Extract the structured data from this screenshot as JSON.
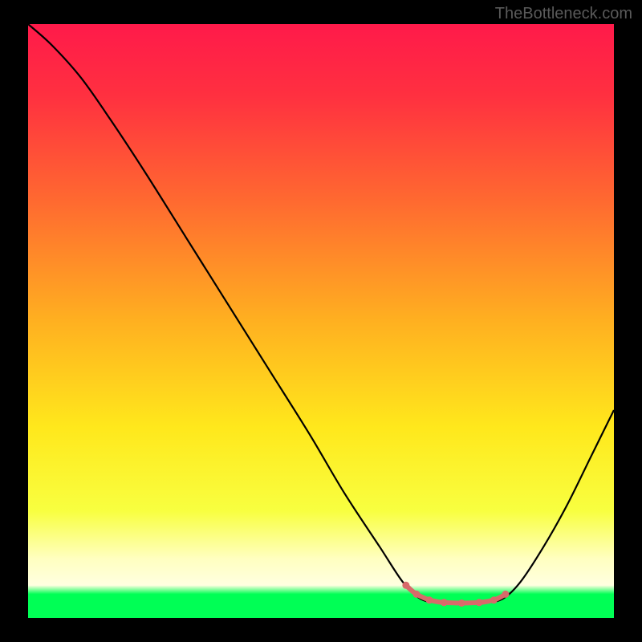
{
  "watermark": "TheBottleneck.com",
  "chart_data": {
    "type": "line",
    "title": "",
    "xlabel": "",
    "ylabel": "",
    "x_range": [
      0,
      100
    ],
    "y_range": [
      0,
      100
    ],
    "gradient_stops": [
      {
        "offset": 0.0,
        "color": "#ff1a4a"
      },
      {
        "offset": 0.12,
        "color": "#ff3040"
      },
      {
        "offset": 0.3,
        "color": "#ff6a30"
      },
      {
        "offset": 0.5,
        "color": "#ffb020"
      },
      {
        "offset": 0.68,
        "color": "#ffe81c"
      },
      {
        "offset": 0.82,
        "color": "#f8ff40"
      },
      {
        "offset": 0.9,
        "color": "#ffffc0"
      },
      {
        "offset": 0.945,
        "color": "#ffffe0"
      },
      {
        "offset": 0.96,
        "color": "#00ff55"
      },
      {
        "offset": 1.0,
        "color": "#00ff55"
      }
    ],
    "curve": [
      {
        "x": 0,
        "y": 100
      },
      {
        "x": 4,
        "y": 96.5
      },
      {
        "x": 9,
        "y": 91
      },
      {
        "x": 14,
        "y": 84
      },
      {
        "x": 20,
        "y": 75
      },
      {
        "x": 27,
        "y": 64
      },
      {
        "x": 34,
        "y": 53
      },
      {
        "x": 41,
        "y": 42
      },
      {
        "x": 48,
        "y": 31
      },
      {
        "x": 54,
        "y": 21
      },
      {
        "x": 60,
        "y": 12
      },
      {
        "x": 64,
        "y": 6
      },
      {
        "x": 67,
        "y": 3.2
      },
      {
        "x": 70,
        "y": 2.6
      },
      {
        "x": 74,
        "y": 2.5
      },
      {
        "x": 78,
        "y": 2.6
      },
      {
        "x": 81,
        "y": 3.2
      },
      {
        "x": 84,
        "y": 6
      },
      {
        "x": 88,
        "y": 12
      },
      {
        "x": 92,
        "y": 19
      },
      {
        "x": 96,
        "y": 27
      },
      {
        "x": 100,
        "y": 35
      }
    ],
    "highlight_segment": [
      {
        "x": 64.5,
        "y": 5.5
      },
      {
        "x": 66,
        "y": 4.2
      },
      {
        "x": 68,
        "y": 3.2
      },
      {
        "x": 70,
        "y": 2.7
      },
      {
        "x": 72,
        "y": 2.55
      },
      {
        "x": 74,
        "y": 2.5
      },
      {
        "x": 76,
        "y": 2.55
      },
      {
        "x": 78,
        "y": 2.7
      },
      {
        "x": 80,
        "y": 3.2
      },
      {
        "x": 81.5,
        "y": 4.0
      }
    ],
    "highlight_dots": [
      {
        "x": 64.5,
        "y": 5.5
      },
      {
        "x": 66.3,
        "y": 4.0
      },
      {
        "x": 68.5,
        "y": 3.0
      },
      {
        "x": 71,
        "y": 2.6
      },
      {
        "x": 74,
        "y": 2.5
      },
      {
        "x": 77,
        "y": 2.6
      },
      {
        "x": 79.5,
        "y": 3.0
      },
      {
        "x": 81.5,
        "y": 4.0
      }
    ],
    "highlight_color": "#d86a6a"
  }
}
